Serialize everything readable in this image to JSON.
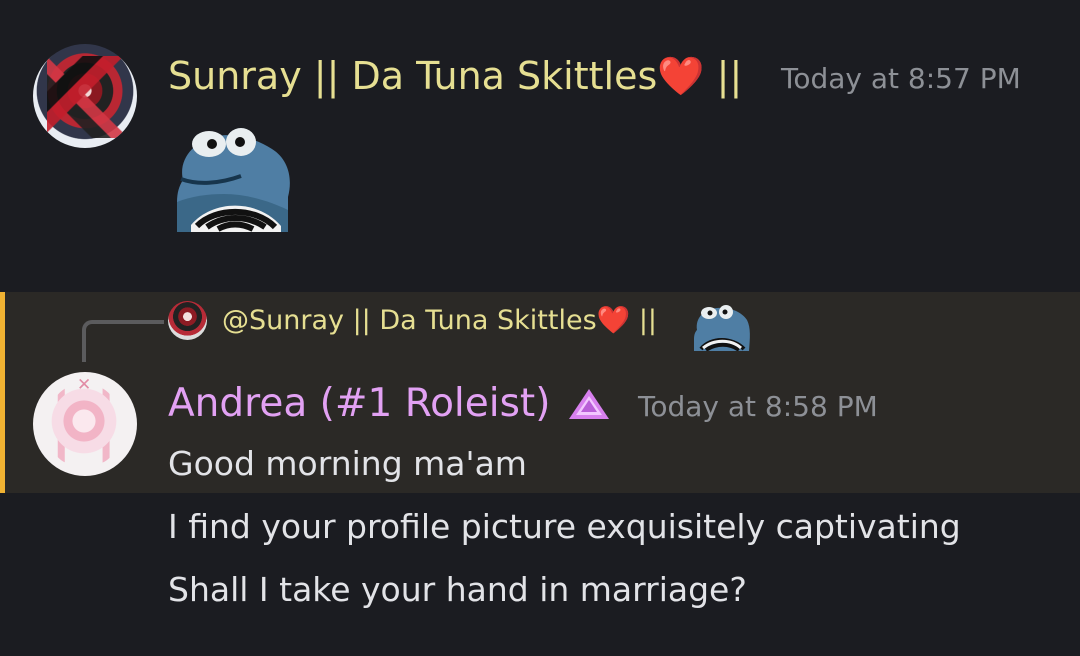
{
  "messages": [
    {
      "author": "Sunray || Da Tuna Skittles❤️ ||",
      "timestamp": "Today at 8:57 PM",
      "sticker": "blue-frog-sticker"
    },
    {
      "reply_to": {
        "author": "@Sunray || Da Tuna Skittles❤️ ||",
        "attachment": "blue-frog-sticker"
      },
      "author": "Andrea (#1 Roleist)",
      "role_icon": "pink-triangle-icon",
      "timestamp": "Today at 8:58 PM",
      "lines": [
        "Good morning ma'am",
        "I find your profile picture exquisitely captivating",
        "Shall I take your hand in marriage?"
      ]
    }
  ],
  "colors": {
    "background": "#1b1c21",
    "reply_highlight": "#2b2926",
    "reply_accent": "#f0b232",
    "sunray_name": "#e6df92",
    "andrea_name": "#e2a1f3",
    "timestamp": "#8d9096",
    "message_text": "#e2e3e7"
  }
}
